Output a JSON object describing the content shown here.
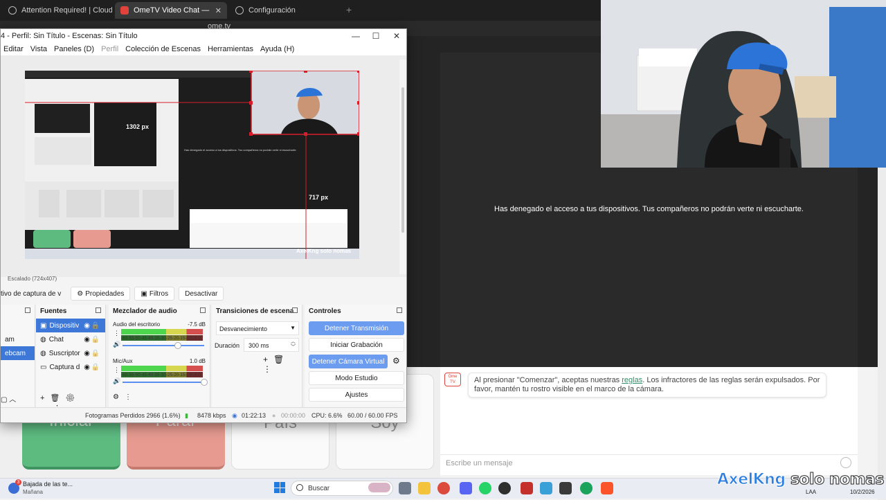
{
  "browser": {
    "tabs": [
      {
        "label": "Attention Required! | Cloudflare"
      },
      {
        "label": "OmeTV Video Chat — Omegle R"
      },
      {
        "label": "Configuración"
      }
    ],
    "url": "ome.tv"
  },
  "omegle": {
    "denied_message": "Has denegado el acceso a tus dispositivos. Tus compañeros no podrán verte ni escucharte.",
    "buttons": {
      "start": "Iniciar",
      "stop": "Parar",
      "country": "País",
      "gender": "Soy"
    },
    "notice_logo": "Ome TV",
    "notice_pre": "Al presionar \"Comenzar\", aceptas nuestras ",
    "notice_link": "reglas",
    "notice_post": ". Los infractores de las reglas serán expulsados. Por favor, mantén tu rostro visible en el marco de la cámara.",
    "message_placeholder": "Escribe un mensaje"
  },
  "obs": {
    "title": "4 - Perfil: Sin Título - Escenas: Sin Título",
    "menu": [
      "Editar",
      "Vista",
      "Paneles (D)",
      "Perfil",
      "Colección de Escenas",
      "Herramientas",
      "Ayuda (H)"
    ],
    "preview": {
      "width_label": "1302 px",
      "height_label": "717 px",
      "inner_message": "Has denegado el acceso a tus dispositivos. Tus compañeros no podrán verte ni escucharte.",
      "watermark": "AxelKng solo nomas"
    },
    "scale_label": "Escalado (724x407)",
    "source_toolbar": {
      "source": "tivo de captura de v",
      "properties": "Propiedades",
      "filters": "Filtros",
      "deactivate": "Desactivar"
    },
    "scenes_partial": [
      "am",
      "ebcam"
    ],
    "sources": {
      "header": "Fuentes",
      "items": [
        {
          "label": "Dispositiv",
          "selected": true
        },
        {
          "label": "Chat",
          "selected": false
        },
        {
          "label": "Suscriptor",
          "selected": false
        },
        {
          "label": "Captura d",
          "selected": false
        }
      ]
    },
    "mixer": {
      "header": "Mezclador de audio",
      "channels": [
        {
          "name": "Audio del escritorio",
          "db": "-7.5 dB",
          "volume": 0.68
        },
        {
          "name": "Mic/Aux",
          "db": "1.0 dB",
          "volume": 1.0
        }
      ],
      "scale": "-60-55-50-45-40-35-30-25-20-15-10 -5  0"
    },
    "transitions": {
      "header": "Transiciones de escena",
      "type": "Desvanecimiento",
      "duration_label": "Duración",
      "duration": "300 ms"
    },
    "controls": {
      "header": "Controles",
      "buttons": [
        {
          "label": "Detener Transmisión",
          "active": true
        },
        {
          "label": "Iniciar Grabación",
          "active": false
        },
        {
          "label": "Detener Cámara Virtual",
          "active": true
        },
        {
          "label": "Modo Estudio",
          "active": false
        },
        {
          "label": "Ajustes",
          "active": false
        }
      ]
    },
    "status": {
      "dropped": "Fotogramas Perdidos 2966 (1.6%)",
      "bitrate": "8478 kbps",
      "stream_time": "01:22:13",
      "rec_time": "00:00:00",
      "cpu": "CPU: 6.6%",
      "fps": "60.00 / 60.00 FPS"
    }
  },
  "taskbar": {
    "weather_title": "Bajada de las te...",
    "weather_sub": "Mañana",
    "weather_badge": "3",
    "search": "Buscar",
    "lang": "LAA",
    "date": "10/2/2026"
  },
  "overlay": {
    "name": "AxelKng",
    "text": "solo nomas e"
  },
  "colors": {
    "obs_selected": "#3d78d8",
    "obs_button_active": "#6b9cf0",
    "omegle_start": "#5dbb80",
    "omegle_stop": "#e79b90",
    "link": "#2f8f6a"
  }
}
